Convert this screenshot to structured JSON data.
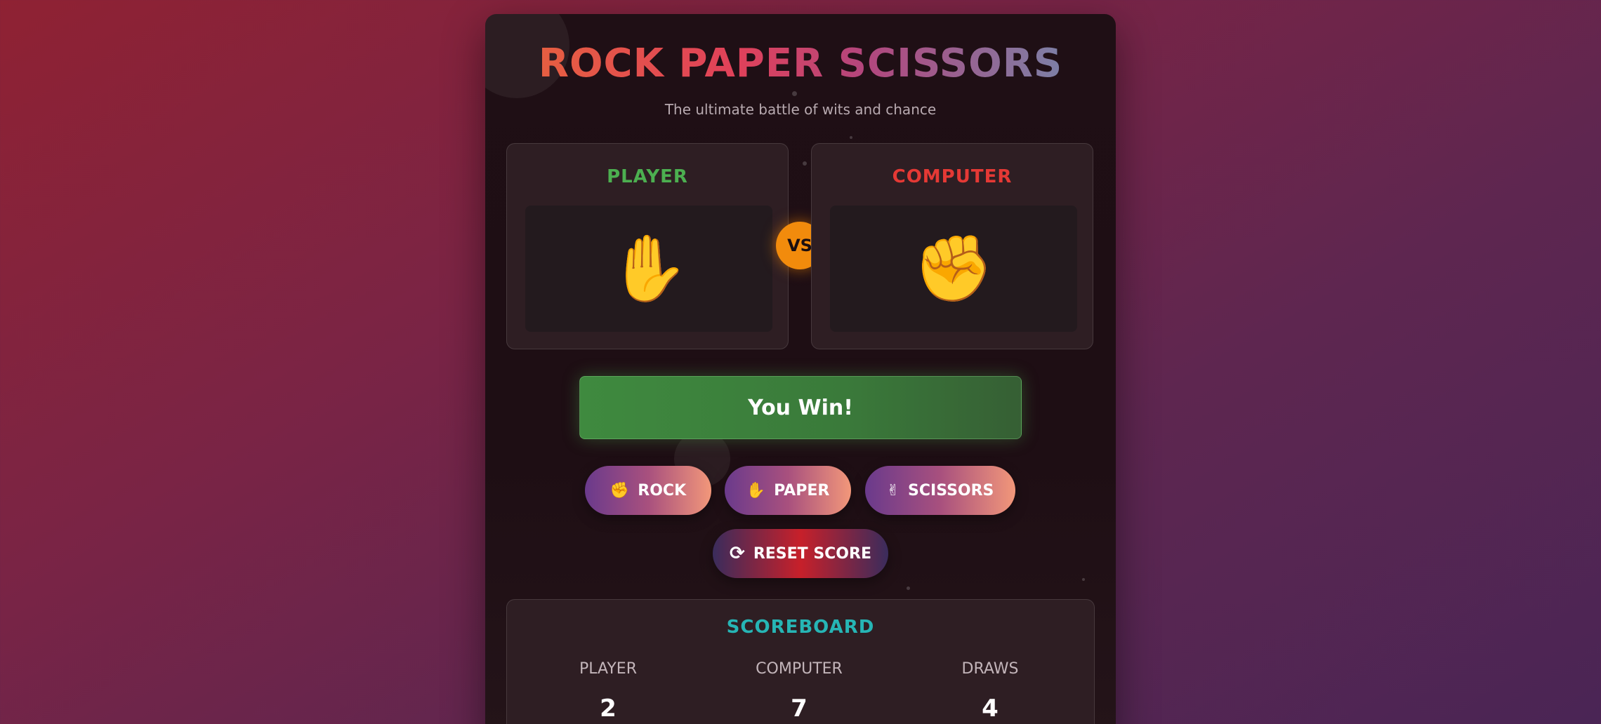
{
  "header": {
    "title": "ROCK PAPER SCISSORS",
    "subtitle": "The ultimate battle of wits and chance"
  },
  "arena": {
    "player_label": "PLAYER",
    "player_choice_emoji": "✋",
    "player_choice_name": "paper-hand-icon",
    "vs_label": "VS",
    "computer_label": "COMPUTER",
    "computer_choice_emoji": "✊",
    "computer_choice_name": "rock-fist-icon",
    "player_color": "#4caf50",
    "computer_color": "#e53935"
  },
  "result": {
    "text": "You Win!",
    "color": "#3f8a3f"
  },
  "choices": {
    "rock_label": "ROCK",
    "rock_icon": "✊",
    "paper_label": "PAPER",
    "paper_icon": "✋",
    "scissors_label": "SCISSORS",
    "scissors_icon": "✌"
  },
  "reset": {
    "label": "RESET SCORE",
    "icon": "⟳"
  },
  "scoreboard": {
    "title": "SCOREBOARD",
    "player_label": "PLAYER",
    "player_score": "2",
    "computer_label": "COMPUTER",
    "computer_score": "7",
    "draws_label": "DRAWS",
    "draws_score": "4"
  }
}
